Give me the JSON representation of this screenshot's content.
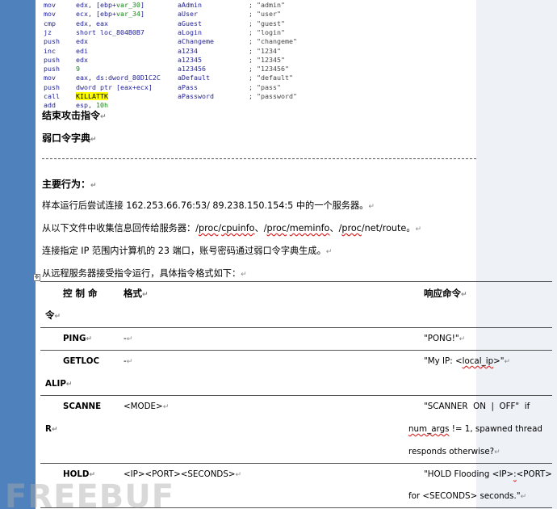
{
  "asm": [
    {
      "mn": "mov",
      "op_pre": "edx, [ebp+",
      "op_green": "var_30",
      "op_post": "]",
      "ref": "aAdmin",
      "val": "; \"admin\""
    },
    {
      "mn": "mov",
      "op_pre": "ecx, [ebp+",
      "op_green": "var_34",
      "op_post": "]",
      "ref": "aUser",
      "val": "; \"user\""
    },
    {
      "mn": "cmp",
      "op_pre": "edx, eax",
      "op_green": "",
      "op_post": "",
      "ref": "aGuest",
      "val": "; \"guest\""
    },
    {
      "mn": "jz",
      "op_pre": "short loc_804B0B7",
      "op_green": "",
      "op_post": "",
      "ref": "aLogin",
      "val": "; \"login\""
    },
    {
      "mn": "push",
      "op_pre": "edx",
      "op_green": "",
      "op_post": "",
      "ref": "aChangeme",
      "val": "; \"changeme\""
    },
    {
      "mn": "inc",
      "op_pre": "edi",
      "op_green": "",
      "op_post": "",
      "ref": "a1234",
      "val": "; \"1234\""
    },
    {
      "mn": "push",
      "op_pre": "edx",
      "op_green": "",
      "op_post": "",
      "ref": "a12345",
      "val": "; \"12345\""
    },
    {
      "mn": "push",
      "op_pre": "",
      "op_green": "9",
      "op_post": "",
      "ref": "a123456",
      "val": "; \"123456\""
    },
    {
      "mn": "mov",
      "op_pre": "eax, ds:dword_80D1C2C",
      "op_green": "",
      "op_post": "",
      "ref": "aDefault",
      "val": "; \"default\""
    },
    {
      "mn": "push",
      "op_pre": "dword ptr [eax+ecx]",
      "op_green": "",
      "op_post": "",
      "ref": "aPass",
      "val": "; \"pass\""
    },
    {
      "mn": "call",
      "op_pre": "",
      "op_green": "",
      "op_post": "",
      "op_hl": "KILLATTK",
      "ref": "aPassword",
      "val": "; \"password\""
    },
    {
      "mn": "add",
      "op_pre": "esp, ",
      "op_green": "10h",
      "op_post": "",
      "ref": "",
      "val": ""
    }
  ],
  "doc": {
    "caption_end_attack": "结束攻击指令",
    "caption_weak_pwd": "弱口令字典",
    "section_title": "主要行为：",
    "p1": "样本运行后尝试连接 162.253.66.76:53/  89.238.150.154:5 中的一个服务器。",
    "p2_pre": "从以下文件中收集信息回传给服务器：/",
    "p2_w1": "proc",
    "p2_m1": "/",
    "p2_w2": "cpuinfo",
    "p2_m2": "、/",
    "p2_w3": "proc",
    "p2_m3": "/",
    "p2_w4": "meminfo",
    "p2_m4": "、/",
    "p2_w5": "proc",
    "p2_post": "/net/route。",
    "p3": "连接指定 IP 范围内计算机的 23 端口，账号密码通过弱口令字典生成。",
    "p4": "从远程服务器接受指令运行，具体指令格式如下：",
    "para_mark": "↵"
  },
  "table": {
    "headers": {
      "cmd_top": "控 制 命",
      "cmd_bottom": "令",
      "format": "格式",
      "response": "响应命令"
    },
    "rows": [
      {
        "cmd": "PING",
        "cmd_wrap": "",
        "format": "-",
        "resp": "\"PONG!\""
      },
      {
        "cmd": "GETLOC",
        "cmd_wrap": "ALIP",
        "format": "-",
        "resp_pre": "\"My IP: <",
        "resp_w": "local_ip",
        "resp_post": ">\""
      },
      {
        "cmd": "SCANNE",
        "cmd_wrap": "R",
        "format": "<MODE>",
        "resp_l1": "\"SCANNER  ON  |  OFF\"  if",
        "resp_l2_w": "num_args",
        "resp_l2": " != 1, spawned thread",
        "resp_l3": "responds otherwise?"
      },
      {
        "cmd": "HOLD",
        "cmd_wrap": "",
        "format": "<IP><PORT><SECONDS>",
        "resp_l1_pre": "\"HOLD Flooding <IP>",
        "resp_l1_w": ":",
        "resp_l1_post": "<PORT>",
        "resp_l2": "for <SECONDS> seconds.\""
      }
    ]
  },
  "watermark": "FREEBUF",
  "colors": {
    "left_bar": "#4f81bd",
    "asm_text": "#1e1e9a",
    "asm_green": "#118a11",
    "highlight": "#ffff00"
  }
}
